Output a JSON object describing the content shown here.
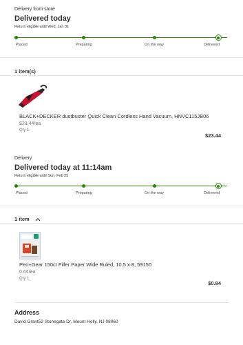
{
  "orders": [
    {
      "type_label": "Delivery from store",
      "status": "Delivered today",
      "return_note": "Return eligible until Wed, Jan 31",
      "steps": [
        "Placed",
        "Preparing",
        "On the way",
        "Delivered"
      ],
      "item_count": "1 item(s)",
      "item": {
        "title": "BLACK+DECKER dustbuster Quick Clean Cordless Hand Vacuum, HNVC115JB06",
        "unit_price": "$23.44/ea",
        "qty": "Qty 1",
        "price": "$23.44",
        "image_icon": "hand-vacuum-icon"
      }
    },
    {
      "type_label": "Delivery",
      "status": "Delivered today at 11:14am",
      "return_note": "Return eligible until Sun, Feb 25",
      "steps": [
        "Placed",
        "Preparing",
        "On the way",
        "Delivered"
      ],
      "item_count": "1 item",
      "item": {
        "title": "Pen+Gear 150ct Filler Paper Wide Ruled, 10.5 x 8, 59150",
        "unit_price": "0.6¢/ea",
        "qty": "Qty 1",
        "price": "$0.84",
        "image_icon": "filler-paper-pack-icon"
      }
    }
  ],
  "address": {
    "title": "Address",
    "text": "David Grant52 Stonegate Dr, Mount Holly, NJ 08060"
  },
  "colors": {
    "progress": "#2a8703",
    "divider": "#e3e4e5"
  }
}
